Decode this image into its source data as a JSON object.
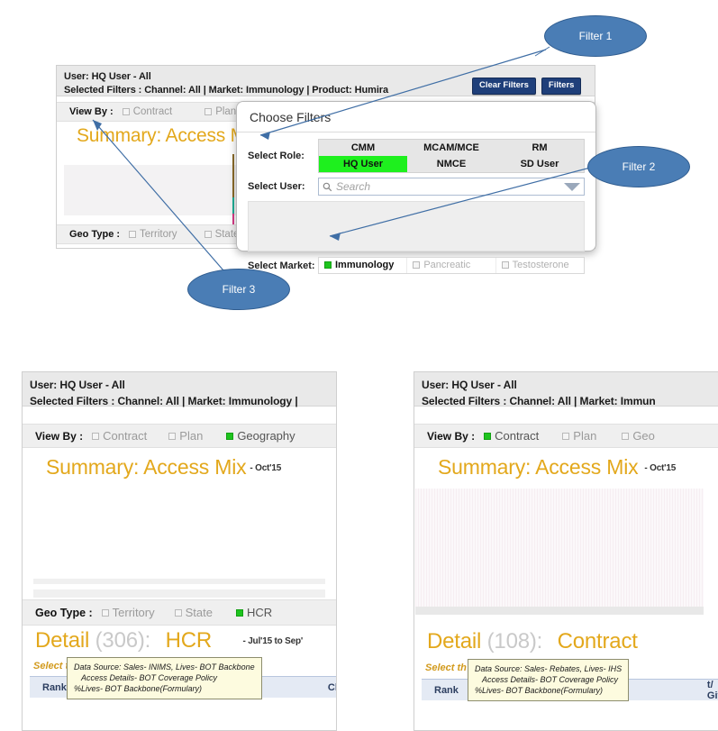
{
  "top_panel": {
    "user_line": "User: HQ User - All",
    "filters_line": "Selected Filters :  Channel: All | Market: Immunology | Product: Humira",
    "clear_filters_label": "Clear Filters",
    "filters_label": "Filters",
    "view_by": {
      "label": "View By :",
      "options": [
        {
          "label": "Contract",
          "selected": false
        },
        {
          "label": "Plan",
          "selected": false
        }
      ]
    },
    "summary_title": "Summary: Access Mix",
    "geo_type": {
      "label": "Geo Type :",
      "options": [
        {
          "label": "Territory",
          "selected": false
        },
        {
          "label": "State",
          "selected": false
        }
      ]
    }
  },
  "dialog": {
    "title": "Choose Filters",
    "select_role_label": "Select Role:",
    "role_columns": [
      "CMM",
      "MCAM/MCE",
      "RM"
    ],
    "role_row2": [
      {
        "label": "HQ User",
        "selected": true
      },
      {
        "label": "NMCE",
        "selected": false
      },
      {
        "label": "SD User",
        "selected": false
      }
    ],
    "select_user_label": "Select User:",
    "search_placeholder": "Search",
    "search_value": "",
    "search_icon": "magnifier-icon",
    "dropdown_icon": "caret-down-icon",
    "select_market_label": "Select Market:",
    "markets": [
      {
        "label": "Immunology",
        "selected": true
      },
      {
        "label": "Pancreatic",
        "selected": false
      },
      {
        "label": "Testosterone",
        "selected": false
      }
    ]
  },
  "callouts": [
    {
      "label": "Filter 1"
    },
    {
      "label": "Filter 2"
    },
    {
      "label": "Filter 3"
    }
  ],
  "left_panel": {
    "user_line": "User: HQ User - All",
    "filters_line": "Selected Filters :  Channel: All | Market: Immunology |",
    "view_by": {
      "label": "View By :",
      "options": [
        {
          "label": "Contract",
          "selected": false
        },
        {
          "label": "Plan",
          "selected": false
        },
        {
          "label": "Geography",
          "selected": true
        }
      ]
    },
    "summary_title": "Summary: Access Mix",
    "summary_period": "- Oct'15",
    "geo_type": {
      "label": "Geo Type :",
      "options": [
        {
          "label": "Territory",
          "selected": false
        },
        {
          "label": "State",
          "selected": false
        },
        {
          "label": "HCR",
          "selected": true
        }
      ]
    },
    "detail_word": "Detail",
    "detail_count": "(306):",
    "detail_dimension": "HCR",
    "detail_period": "- Jul'15 to Sep'",
    "select_text": "Select th",
    "tooltip_lines": [
      "Data Source: Sales- INIMS, Lives- BOT Backbone",
      "Access Details- BOT Coverage Policy",
      "%Lives- BOT Backbone(Formulary)"
    ],
    "table_headers": [
      "Rank",
      "Cl"
    ]
  },
  "right_panel": {
    "user_line": "User: HQ User - All",
    "filters_line": "Selected Filters :  Channel: All | Market: Immun",
    "view_by": {
      "label": "View By :",
      "options": [
        {
          "label": "Contract",
          "selected": true
        },
        {
          "label": "Plan",
          "selected": false
        },
        {
          "label": "Geo",
          "selected": false
        }
      ]
    },
    "summary_title": "Summary: Access Mix",
    "summary_period": "- Oct'15",
    "detail_word": "Detail",
    "detail_count": "(108):",
    "detail_dimension": "Contract",
    "select_text": "Select th",
    "tooltip_lines": [
      "Data Source: Sales- Rebates, Lives- IHS",
      "Access Details- BOT Coverage Policy",
      "%Lives- BOT Backbone(Formulary)"
    ],
    "table_headers": [
      "Rank",
      "t/ Give"
    ]
  },
  "colors": {
    "accent_gold": "#e3a81c",
    "callout_fill": "#4a7db5",
    "callout_border": "#2f5c8f",
    "button_navy": "#1f3f7a",
    "selected_green": "#1ec41e",
    "role_highlight_green": "#1ef01e",
    "tooltip_bg": "#fdfbdf",
    "table_head_bg": "#e4eaf4"
  }
}
